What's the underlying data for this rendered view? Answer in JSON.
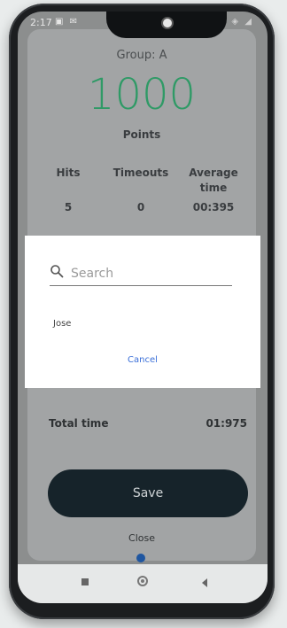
{
  "status_bar": {
    "time": "2:17",
    "left_icons": "▣ ✉",
    "right_icons": "✱ ◈ ◢",
    "icon_names": [
      "gallery-notification-icon",
      "mail-notification-icon",
      "bluetooth-icon",
      "wifi-icon",
      "signal-icon"
    ]
  },
  "summary": {
    "group_label": "Group: A",
    "points_value": "1000",
    "points_label": "Points",
    "points_color": "#2f9a66",
    "stats": [
      {
        "label": "Hits",
        "value": "5"
      },
      {
        "label": "Timeouts",
        "value": "0"
      },
      {
        "label": "Average time",
        "value": "00:395"
      }
    ],
    "total_label": "Total time",
    "total_value": "01:975"
  },
  "dialog": {
    "search_placeholder": "Search",
    "search_value": "",
    "results": [
      "Jose"
    ],
    "cancel_label": "Cancel"
  },
  "actions": {
    "save_label": "Save",
    "close_label": "Close"
  },
  "nav": {
    "icons": [
      "recents-icon",
      "home-icon",
      "back-icon"
    ]
  }
}
